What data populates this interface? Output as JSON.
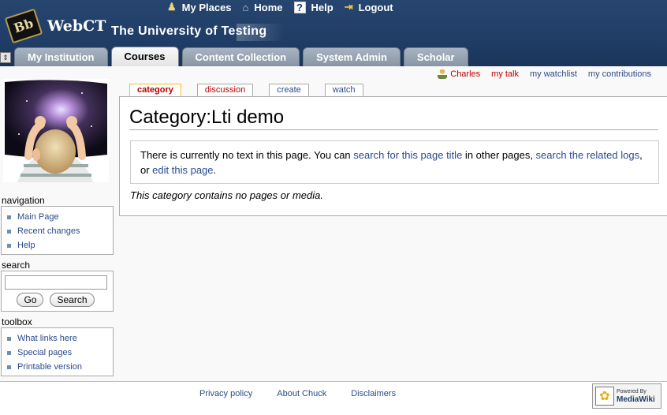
{
  "webct": {
    "topnav": [
      {
        "label": "My Places",
        "icon": "places-icon"
      },
      {
        "label": "Home",
        "icon": "home-icon"
      },
      {
        "label": "Help",
        "icon": "help-icon"
      },
      {
        "label": "Logout",
        "icon": "logout-icon"
      }
    ],
    "brand": "WebCT",
    "logo_mark": "Bb",
    "institution": "The University of Testing",
    "tabs": [
      {
        "label": "My Institution",
        "active": false
      },
      {
        "label": "Courses",
        "active": true
      },
      {
        "label": "Content Collection",
        "active": false
      },
      {
        "label": "System Admin",
        "active": false
      },
      {
        "label": "Scholar",
        "active": false
      }
    ]
  },
  "personal": {
    "user": "Charles",
    "talk": "my talk",
    "watchlist": "my watchlist",
    "contributions": "my contributions"
  },
  "page_tabs": {
    "category": "category",
    "discussion": "discussion",
    "create": "create",
    "watch": "watch"
  },
  "content": {
    "heading": "Category:Lti demo",
    "notice_prefix": "There is currently no text in this page. You can ",
    "notice_link1": "search for this page title",
    "notice_mid1": " in other pages, ",
    "notice_link2": "search the related logs",
    "notice_mid2": ", or ",
    "notice_link3": "edit this page",
    "notice_suffix": ".",
    "empty_note": "This category contains no pages or media."
  },
  "sidebar": {
    "navigation": {
      "title": "navigation",
      "items": [
        "Main Page",
        "Recent changes",
        "Help"
      ]
    },
    "search": {
      "title": "search",
      "value": "",
      "go_label": "Go",
      "search_label": "Search"
    },
    "toolbox": {
      "title": "toolbox",
      "items": [
        "What links here",
        "Special pages",
        "Printable version"
      ]
    }
  },
  "footer": {
    "links": [
      "Privacy policy",
      "About Chuck",
      "Disclaimers"
    ],
    "powered_small": "Powered By",
    "powered_big": "MediaWiki"
  },
  "colors": {
    "header_blue": "#1f3d66",
    "link": "#2a4b8d",
    "new_link": "#ba0000",
    "selected_tab": "#fabd23"
  }
}
